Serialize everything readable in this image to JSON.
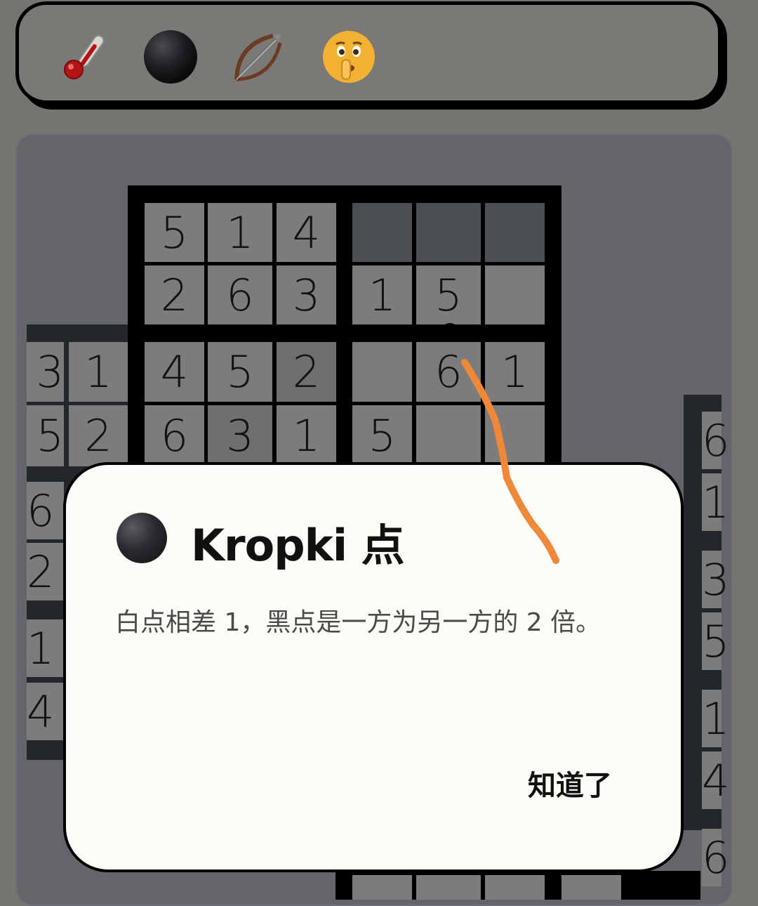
{
  "toolbar": {
    "tools": [
      {
        "icon": "thermometer-icon"
      },
      {
        "icon": "black-circle-icon"
      },
      {
        "icon": "bow-and-arrow-icon"
      },
      {
        "icon": "shushing-face-icon"
      }
    ]
  },
  "board": {
    "top_rows": [
      [
        "5",
        "1",
        "4",
        "",
        "",
        ""
      ],
      [
        "2",
        "6",
        "3",
        "1",
        "5",
        ""
      ]
    ],
    "mid_rows": [
      [
        "3",
        "1",
        "4",
        "5",
        "2",
        "",
        "6",
        "1"
      ],
      [
        "5",
        "2",
        "6",
        "3",
        "1",
        "5",
        "",
        ""
      ]
    ],
    "left_strip": [
      "6",
      "2",
      "1",
      "4"
    ],
    "right_strip": [
      "6",
      "1",
      "3",
      "5",
      "1",
      "4",
      "6"
    ]
  },
  "dialog": {
    "title": "Kropki 点",
    "body": "白点相差 1，黑点是一方为另一方的 2 倍。",
    "ok_label": "知道了"
  },
  "colors": {
    "background": "#75746f",
    "dialog": "#fdfcf7",
    "annotation_stroke": "#f0883a"
  }
}
